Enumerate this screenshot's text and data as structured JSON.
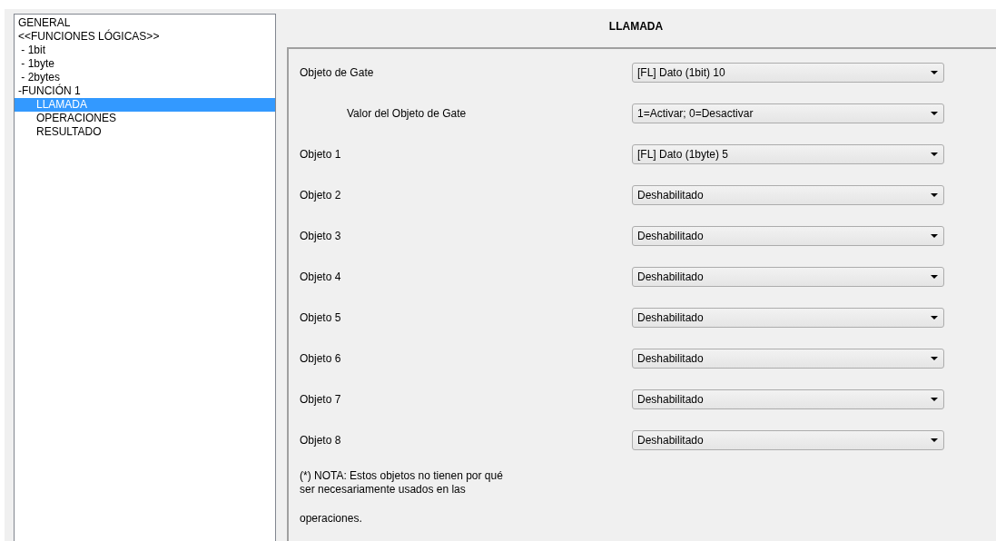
{
  "sidebar": {
    "items": [
      {
        "label": "GENERAL",
        "selected": false
      },
      {
        "label": "<<FUNCIONES LÓGICAS>>",
        "selected": false
      },
      {
        "label": " - 1bit",
        "selected": false
      },
      {
        "label": " - 1byte",
        "selected": false
      },
      {
        "label": " - 2bytes",
        "selected": false
      },
      {
        "label": "-FUNCIÓN 1",
        "selected": false,
        "children": [
          {
            "label": "LLAMADA",
            "selected": true
          },
          {
            "label": "OPERACIONES",
            "selected": false
          },
          {
            "label": "RESULTADO",
            "selected": false
          }
        ]
      }
    ]
  },
  "panel": {
    "title": "LLAMADA",
    "rows": [
      {
        "label": "Objeto de Gate",
        "value": "[FL] Dato (1bit) 10",
        "indented": false
      },
      {
        "label": "Valor del Objeto de Gate",
        "value": "1=Activar; 0=Desactivar",
        "indented": true
      },
      {
        "label": "Objeto 1",
        "value": "[FL] Dato (1byte) 5",
        "indented": false
      },
      {
        "label": "Objeto 2",
        "value": "Deshabilitado",
        "indented": false
      },
      {
        "label": "Objeto 3",
        "value": "Deshabilitado",
        "indented": false
      },
      {
        "label": "Objeto 4",
        "value": "Deshabilitado",
        "indented": false
      },
      {
        "label": "Objeto 5",
        "value": "Deshabilitado",
        "indented": false
      },
      {
        "label": "Objeto 6",
        "value": "Deshabilitado",
        "indented": false
      },
      {
        "label": "Objeto 7",
        "value": "Deshabilitado",
        "indented": false
      },
      {
        "label": "Objeto 8",
        "value": "Deshabilitado",
        "indented": false
      }
    ],
    "note": [
      "(*) NOTA: Estos objetos no tienen por qué ser necesariamente usados en las",
      "operaciones."
    ]
  }
}
